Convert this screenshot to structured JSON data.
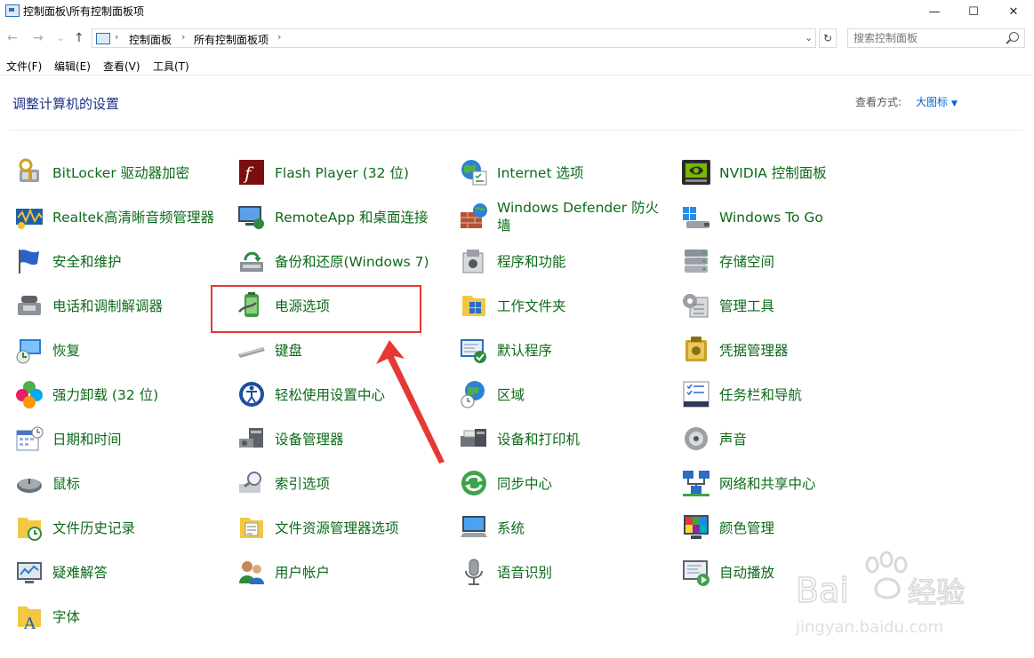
{
  "window": {
    "title": "控制面板\\所有控制面板项",
    "controls": {
      "minimize": "—",
      "maximize": "☐",
      "close": "✕"
    }
  },
  "address": {
    "crumbs": [
      "控制面板",
      "所有控制面板项"
    ],
    "search_placeholder": "搜索控制面板"
  },
  "menu": [
    "文件(F)",
    "编辑(E)",
    "查看(V)",
    "工具(T)"
  ],
  "header": {
    "title": "调整计算机的设置",
    "view_by_label": "查看方式:",
    "view_by_value": "大图标"
  },
  "items": [
    {
      "label": "BitLocker 驱动器加密",
      "icon": "bitlocker-icon"
    },
    {
      "label": "Flash Player (32 位)",
      "icon": "flash-player-icon"
    },
    {
      "label": "Internet 选项",
      "icon": "internet-options-icon"
    },
    {
      "label": "NVIDIA 控制面板",
      "icon": "nvidia-icon"
    },
    {
      "label": "Realtek高清晰音频管理器",
      "icon": "realtek-audio-icon"
    },
    {
      "label": "RemoteApp 和桌面连接",
      "icon": "remoteapp-icon"
    },
    {
      "label": "Windows Defender 防火墙",
      "icon": "firewall-icon"
    },
    {
      "label": "Windows To Go",
      "icon": "windows-to-go-icon"
    },
    {
      "label": "安全和维护",
      "icon": "security-flag-icon"
    },
    {
      "label": "备份和还原(Windows 7)",
      "icon": "backup-restore-icon"
    },
    {
      "label": "程序和功能",
      "icon": "programs-features-icon"
    },
    {
      "label": "存储空间",
      "icon": "storage-spaces-icon"
    },
    {
      "label": "电话和调制解调器",
      "icon": "phone-modem-icon"
    },
    {
      "label": "电源选项",
      "icon": "power-options-icon"
    },
    {
      "label": "工作文件夹",
      "icon": "work-folders-icon"
    },
    {
      "label": "管理工具",
      "icon": "admin-tools-icon"
    },
    {
      "label": "恢复",
      "icon": "recovery-icon"
    },
    {
      "label": "键盘",
      "icon": "keyboard-icon"
    },
    {
      "label": "默认程序",
      "icon": "default-programs-icon"
    },
    {
      "label": "凭据管理器",
      "icon": "credential-manager-icon"
    },
    {
      "label": "强力卸载 (32 位)",
      "icon": "uninstaller-icon"
    },
    {
      "label": "轻松使用设置中心",
      "icon": "ease-of-access-icon"
    },
    {
      "label": "区域",
      "icon": "region-icon"
    },
    {
      "label": "任务栏和导航",
      "icon": "taskbar-navigation-icon"
    },
    {
      "label": "日期和时间",
      "icon": "date-time-icon"
    },
    {
      "label": "设备管理器",
      "icon": "device-manager-icon"
    },
    {
      "label": "设备和打印机",
      "icon": "devices-printers-icon"
    },
    {
      "label": "声音",
      "icon": "sound-icon"
    },
    {
      "label": "鼠标",
      "icon": "mouse-icon"
    },
    {
      "label": "索引选项",
      "icon": "indexing-options-icon"
    },
    {
      "label": "同步中心",
      "icon": "sync-center-icon"
    },
    {
      "label": "网络和共享中心",
      "icon": "network-sharing-icon"
    },
    {
      "label": "文件历史记录",
      "icon": "file-history-icon"
    },
    {
      "label": "文件资源管理器选项",
      "icon": "explorer-options-icon"
    },
    {
      "label": "系统",
      "icon": "system-icon"
    },
    {
      "label": "颜色管理",
      "icon": "color-management-icon"
    },
    {
      "label": "疑难解答",
      "icon": "troubleshooting-icon"
    },
    {
      "label": "用户帐户",
      "icon": "user-accounts-icon"
    },
    {
      "label": "语音识别",
      "icon": "speech-recognition-icon"
    },
    {
      "label": "自动播放",
      "icon": "autoplay-icon"
    },
    {
      "label": "字体",
      "icon": "fonts-icon"
    }
  ],
  "annotation": {
    "highlighted_item": "电源选项",
    "color": "#e53935"
  },
  "watermark": {
    "brand": "Bai du 经验",
    "url": "jingyan.baidu.com"
  }
}
